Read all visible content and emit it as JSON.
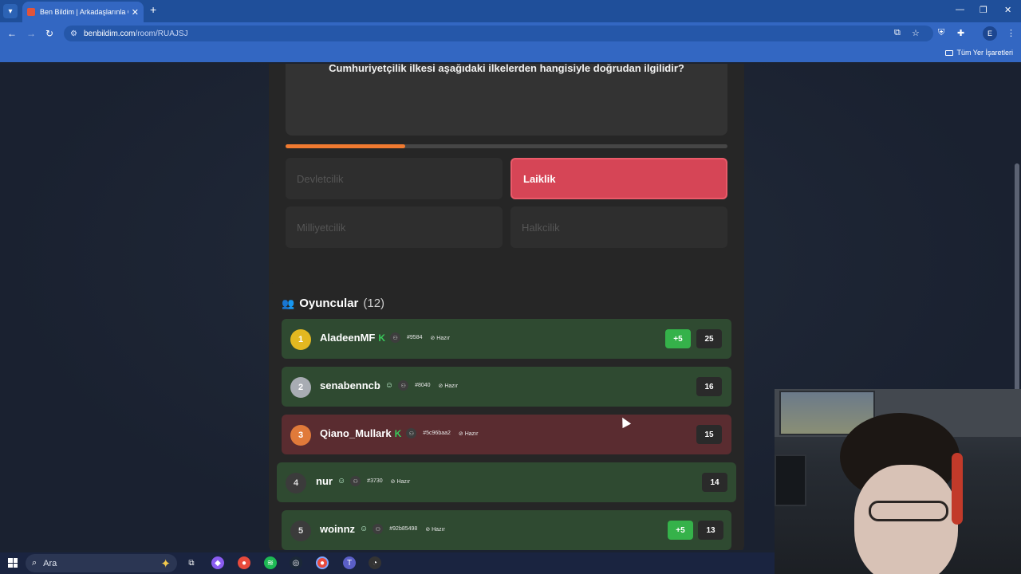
{
  "browser": {
    "tab_title": "Ben Bildim | Arkadaşlarınla Onli",
    "new_tab": "+",
    "url_host": "benbildim.com",
    "url_path": "/room/RUAJSJ",
    "profile_initial": "E",
    "bookmarks_label": "Tüm Yer İşaretleri"
  },
  "quiz": {
    "question": "Cumhuriyetçilik ilkesi aşağıdaki ilkelerden hangisiyle doğrudan ilgilidir?",
    "progress": 0.27,
    "answers": [
      {
        "label": "Devletcilik",
        "state": "dimmed"
      },
      {
        "label": "Laiklik",
        "state": "correct"
      },
      {
        "label": "Milliyetcilik",
        "state": "dimmed"
      },
      {
        "label": "Halkcilik",
        "state": "dimmed"
      }
    ]
  },
  "players": {
    "title": "Oyuncular",
    "count": "(12)",
    "list": [
      {
        "rank": "1",
        "name": "AladeenMF",
        "tag": "#9584",
        "status": "Hazır",
        "bonus": "+5",
        "score": "25"
      },
      {
        "rank": "2",
        "name": "senabenncb",
        "tag": "#8040",
        "status": "Hazır",
        "bonus": "",
        "score": "16"
      },
      {
        "rank": "3",
        "name": "Qiano_Mullark",
        "tag": "#5c96baa2",
        "status": "Hazır",
        "bonus": "",
        "score": "15"
      },
      {
        "rank": "4",
        "name": "nur",
        "tag": "#3730",
        "status": "Hazır",
        "bonus": "",
        "score": "14"
      },
      {
        "rank": "5",
        "name": "woinnz",
        "tag": "#92b85498",
        "status": "Hazır",
        "bonus": "+5",
        "score": "13"
      }
    ]
  },
  "taskbar": {
    "search_placeholder": "Ara"
  },
  "colors": {
    "accent_orange": "#f07a30",
    "correct_red": "#d64556",
    "row_green": "#2f4a31",
    "row_red": "#5a2c30",
    "bonus_green": "#35b24a"
  }
}
